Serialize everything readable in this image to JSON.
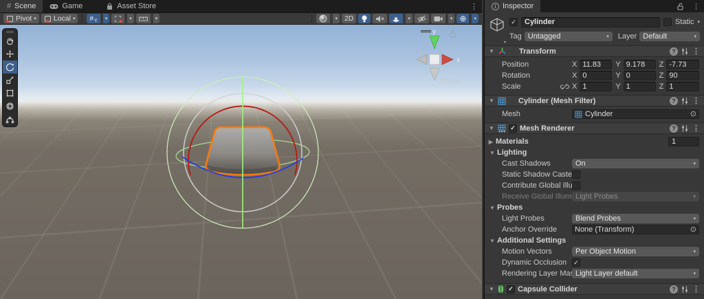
{
  "window": {
    "scene_tab": "Scene",
    "game_tab": "Game",
    "asset_store_tab": "Asset Store"
  },
  "toolbar": {
    "pivot": "Pivot",
    "local": "Local",
    "two_d": "2D",
    "grid_axis": "Y"
  },
  "scene": {
    "persp": "Persp",
    "axis_x": "x",
    "axis_y": "y"
  },
  "icons": {
    "check": "✓",
    "dropdown": "▾",
    "kebab": "⋮",
    "target": "⊙",
    "foldout_open": "▼",
    "foldout_closed": "▶",
    "help": "?",
    "info": "i",
    "scene_grid": "#",
    "gizmo": "⊕",
    "chevron_left": "‹"
  },
  "colors": {
    "accent_blue": "#3e5f8a",
    "selection_orange": "#f47a12",
    "mesh_icon_blue": "#4a9ede",
    "collider_green": "#6fc96f"
  },
  "inspector": {
    "tab": "Inspector",
    "gameobject": {
      "name": "Cylinder",
      "static_label": "Static",
      "tag_label": "Tag",
      "tag_value": "Untagged",
      "layer_label": "Layer",
      "layer_value": "Default"
    },
    "labels": {
      "x": "X",
      "y": "Y",
      "z": "Z"
    },
    "transform": {
      "title": "Transform",
      "position_label": "Position",
      "position": {
        "x": "11.83",
        "y": "9.178",
        "z": "-7.73"
      },
      "rotation_label": "Rotation",
      "rotation": {
        "x": "0",
        "y": "0",
        "z": "90"
      },
      "scale_label": "Scale",
      "scale": {
        "x": "1",
        "y": "1",
        "z": "1"
      }
    },
    "mesh_filter": {
      "title": "Cylinder (Mesh Filter)",
      "mesh_label": "Mesh",
      "mesh_value": "Cylinder"
    },
    "mesh_renderer": {
      "title": "Mesh Renderer",
      "materials_label": "Materials",
      "materials_value": "1",
      "lighting_title": "Lighting",
      "cast_shadows_label": "Cast Shadows",
      "cast_shadows_value": "On",
      "static_shadow_label": "Static Shadow Caster",
      "contribute_gi_label": "Contribute Global Illu",
      "receive_gi_label": "Receive Global Illumi",
      "receive_gi_value": "Light Probes",
      "probes_title": "Probes",
      "light_probes_label": "Light Probes",
      "light_probes_value": "Blend Probes",
      "anchor_label": "Anchor Override",
      "anchor_value": "None (Transform)",
      "additional_title": "Additional Settings",
      "motion_vectors_label": "Motion Vectors",
      "motion_vectors_value": "Per Object Motion",
      "dynamic_occlusion_label": "Dynamic Occlusion",
      "rendering_mask_label": "Rendering Layer Mas",
      "rendering_mask_value": "Light Layer default"
    },
    "capsule_collider": {
      "title": "Capsule Collider"
    }
  }
}
